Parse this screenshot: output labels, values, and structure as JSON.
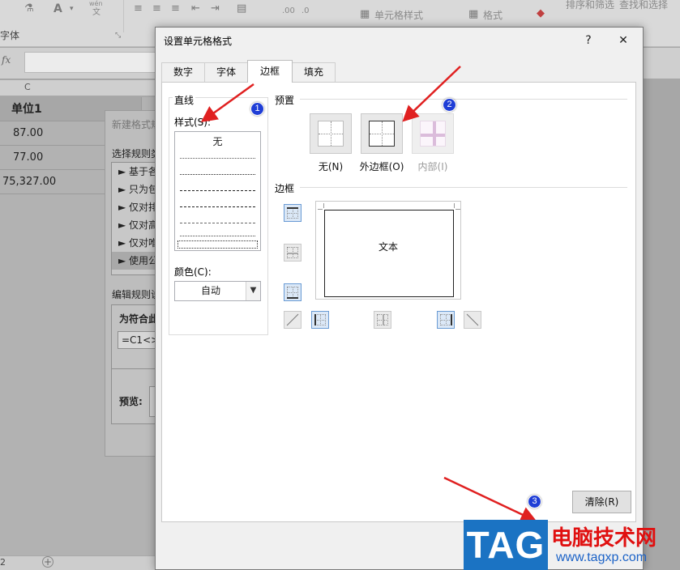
{
  "ribbon": {
    "font_group_label": "字体",
    "pinyin_icon_text": "wén",
    "pinyin_icon_char": "文",
    "cell_style_label": "单元格样式",
    "format_label": "格式",
    "sort_filter_label": "排序和筛选",
    "find_select_label": "查找和选择",
    "decimal_inc_label": ".00",
    "decimal_dec_label": ".0"
  },
  "formula_bar": {
    "fx_label": "fx"
  },
  "sheet": {
    "column_letter": "C",
    "cells": [
      "单位1",
      "87.00",
      "77.00",
      "75,327.00"
    ],
    "sheet_tab_fragment": "2"
  },
  "background_dialog": {
    "title": "新建格式规",
    "select_rule_label": "选择规则类",
    "rule_items": [
      "► 基于各",
      "► 只为包",
      "► 仅对排",
      "► 仅对高",
      "► 仅对唯",
      "► 使用公"
    ],
    "edit_rule_label": "编辑规则说",
    "formula_label": "为符合此",
    "formula_value": "=C1<>",
    "preview_label": "预览:"
  },
  "dialog": {
    "title": "设置单元格格式",
    "help_label": "?",
    "close_label": "✕",
    "tabs": [
      "数字",
      "字体",
      "边框",
      "填充"
    ],
    "active_tab": "边框",
    "line_group": {
      "label": "直线",
      "style_label": "样式(S):",
      "none_style_label": "无",
      "color_label": "颜色(C):",
      "color_value": "自动"
    },
    "presets": {
      "label": "预置",
      "none_label": "无(N)",
      "outline_label": "外边框(O)",
      "inside_label": "内部(I)"
    },
    "border": {
      "label": "边框",
      "preview_text": "文本"
    },
    "clear_button": "清除(R)"
  },
  "annotations": {
    "badges": [
      "1",
      "2",
      "3"
    ],
    "badge_color": "#1f3ed6",
    "arrow_color": "#e02020"
  },
  "watermark": {
    "logo_text": "TAG",
    "site_name": "电脑技术网",
    "url": "www.tagxp.com",
    "logo_color": "#1b73c3",
    "name_color": "#e01010"
  }
}
